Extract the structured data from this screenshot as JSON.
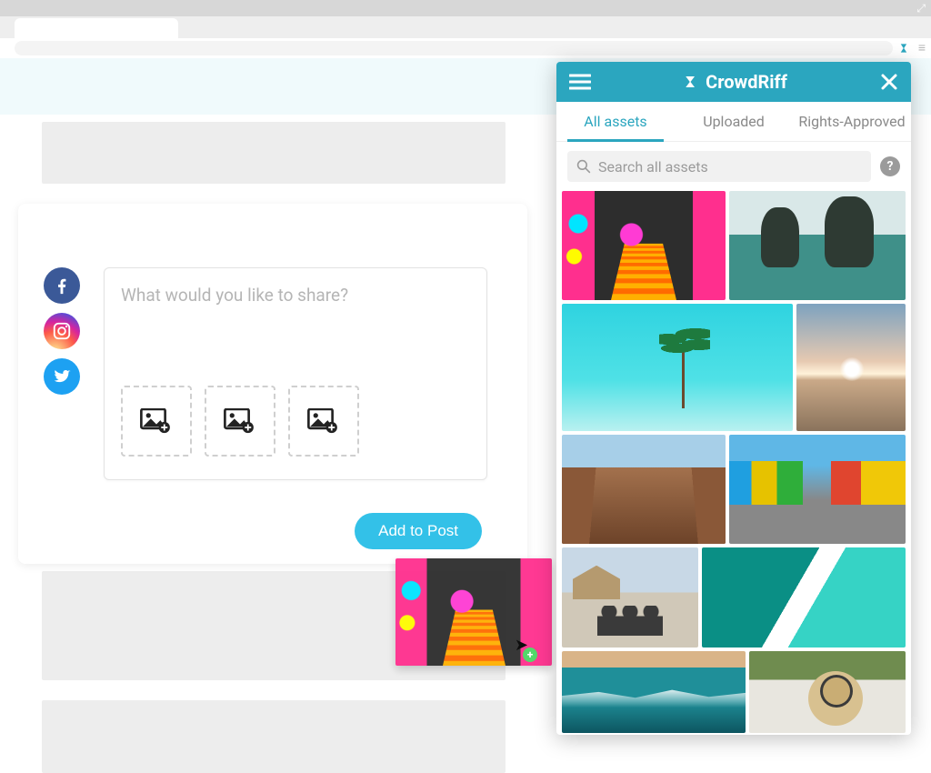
{
  "composer": {
    "placeholder": "What would you like to share?",
    "add_button": "Add to Post",
    "socials": [
      "facebook",
      "instagram",
      "twitter"
    ]
  },
  "panel": {
    "brand": "CrowdRiff",
    "tabs": {
      "all": "All assets",
      "uploaded": "Uploaded",
      "rights": "Rights-Approved"
    },
    "search_placeholder": "Search all assets",
    "help_label": "?"
  }
}
